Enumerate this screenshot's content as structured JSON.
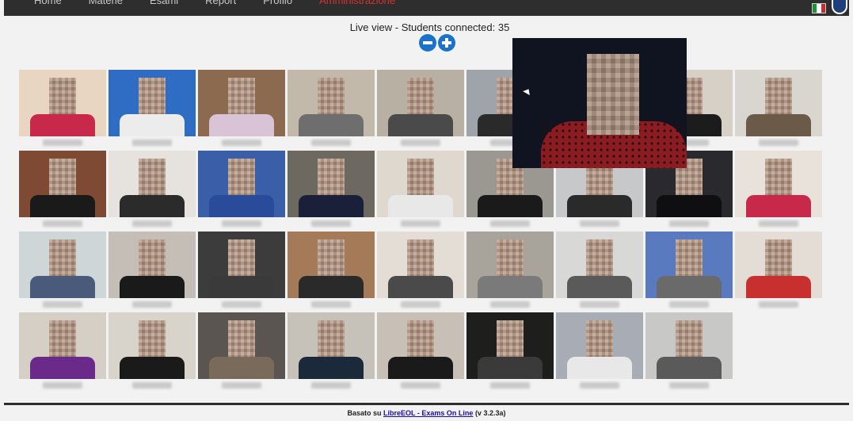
{
  "nav": {
    "items": [
      "Home",
      "Materie",
      "Esami",
      "Report",
      "Profilo",
      "Amministrazione"
    ],
    "active_index": 5,
    "language_flag": "it-flag-icon",
    "user_icon": "user-circle-icon"
  },
  "header": {
    "title": "Live view - Students connected: 35",
    "zoom_out": "minus-circle-icon",
    "zoom_in": "plus-circle-icon"
  },
  "footer": {
    "prefix": "Basato su",
    "link": "LibreEOL - Exams On Line",
    "version": "(v 3.2.3a)"
  },
  "colors": {
    "navbar": "#2e2e2e",
    "accent": "#1a73c9",
    "active_nav": "#d6312f"
  },
  "tiles": [
    {
      "bg": "#e9d6c2",
      "body": "#c8284a"
    },
    {
      "bg": "#2f6cc4",
      "body": "#ececec"
    },
    {
      "bg": "#8b6a4f",
      "body": "#d8c4d6"
    },
    {
      "bg": "#c2b9aa",
      "body": "#6e6e6e"
    },
    {
      "bg": "#b9b0a4",
      "body": "#4a4a4a"
    },
    {
      "bg": "#9fa3aa",
      "body": "#2a2a2a"
    },
    {
      "bg": "#7a7164",
      "body": "#3a3a3a"
    },
    {
      "bg": "#d6d0c7",
      "body": "#1c1c1c"
    },
    {
      "bg": "#d9d6cf",
      "body": "#6b5a48"
    },
    {
      "bg": "#7e4a33",
      "body": "#1a1a1a"
    },
    {
      "bg": "#e6e3de",
      "body": "#2b2b2b"
    },
    {
      "bg": "#3a5ea8",
      "body": "#2a4a9a"
    },
    {
      "bg": "#6d6860",
      "body": "#1a1f3a"
    },
    {
      "bg": "#ded8cf",
      "body": "#e8e8e8"
    },
    {
      "bg": "#9a9890",
      "body": "#1a1a1a"
    },
    {
      "bg": "#c6c8ca",
      "body": "#2a2a2a"
    },
    {
      "bg": "#2a2a2e",
      "body": "#0f0f12"
    },
    {
      "bg": "#e8e2da",
      "body": "#c8284a"
    },
    {
      "bg": "#cfd6d8",
      "body": "#4a5a7a"
    },
    {
      "bg": "#c4beb6",
      "body": "#1a1a1a"
    },
    {
      "bg": "#3c3c3c",
      "body": "#3a3a3a"
    },
    {
      "bg": "#a57a58",
      "body": "#2a2a2a"
    },
    {
      "bg": "#e3ddd5",
      "body": "#4a4a4a"
    },
    {
      "bg": "#a8a49c",
      "body": "#7a7a7a"
    },
    {
      "bg": "#d8d8d6",
      "body": "#5a5a5a"
    },
    {
      "bg": "#5a7ac0",
      "body": "#6a6a6a"
    },
    {
      "bg": "#e4ddd6",
      "body": "#c83030"
    },
    {
      "bg": "#d6cfc6",
      "body": "#6a2a8a"
    },
    {
      "bg": "#d8d4cc",
      "body": "#1a1a1a"
    },
    {
      "bg": "#5a5550",
      "body": "#7a6a5a"
    },
    {
      "bg": "#c6c2ba",
      "body": "#1a2a3a"
    },
    {
      "bg": "#c8c0b6",
      "body": "#1a1a1a"
    },
    {
      "bg": "#1e1e1c",
      "body": "#3a3a3a"
    },
    {
      "bg": "#a8acb4",
      "body": "#e8e8e8"
    },
    {
      "bg": "#c8c8c6",
      "body": "#5a5a5a"
    }
  ]
}
